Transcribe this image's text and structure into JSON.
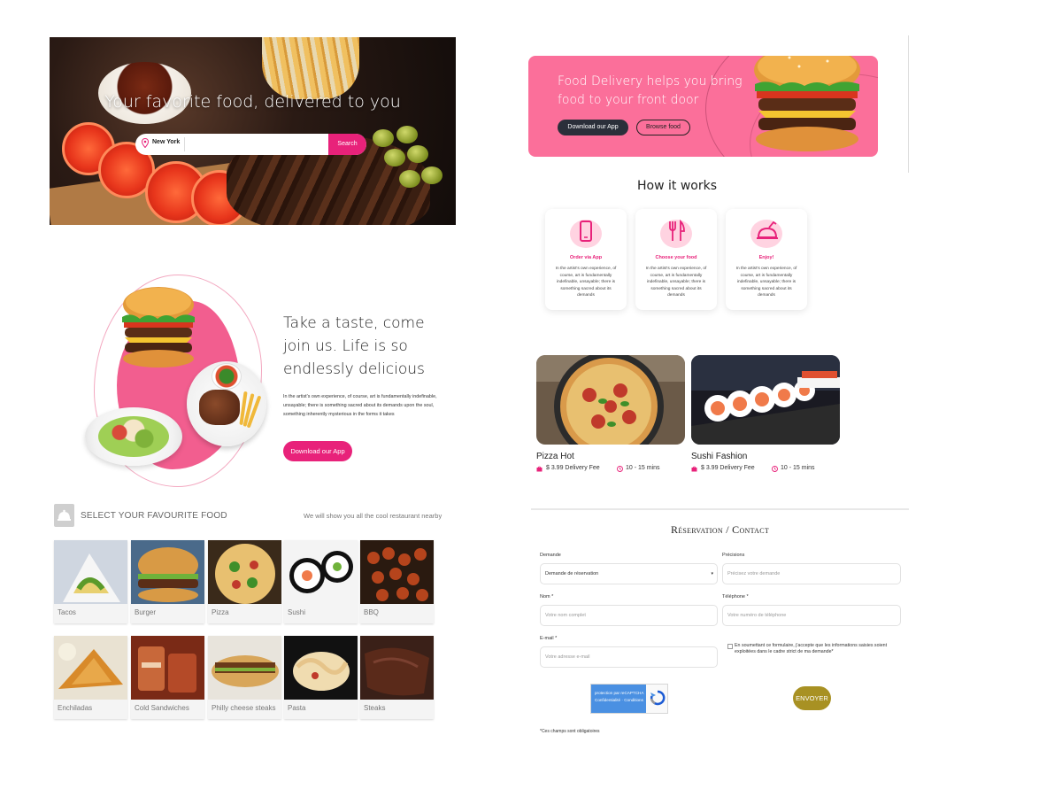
{
  "hero": {
    "title": "Your favorite food, delivered to you",
    "location_value": "New York",
    "search_button": "Search"
  },
  "banner": {
    "headline": "Food Delivery helps you bring food to your front door",
    "download_button": "Download our App",
    "browse_button": "Browse food",
    "color": "#fb6f9a"
  },
  "how": {
    "title": "How it works",
    "steps": [
      {
        "title": "Order via App",
        "desc": "In the artist's own experience, of course, art is fundamentally indefinable, unsayable; there is something sacred about its demands",
        "icon": "phone-icon"
      },
      {
        "title": "Choose your food",
        "desc": "In the artist's own experience, of course, art is fundamentally indefinable, unsayable; there is something sacred about its demands",
        "icon": "fork-knife-icon"
      },
      {
        "title": "Enjoy!",
        "desc": "In the artist's own experience, of course, art is fundamentally indefinable, unsayable; there is something sacred about its demands",
        "icon": "food-cover-icon"
      }
    ]
  },
  "restaurants": [
    {
      "name": "Pizza Hot",
      "fee": "$ 3.99 Delivery Fee",
      "time": "10 - 15 mins"
    },
    {
      "name": "Sushi Fashion",
      "fee": "$ 3.99 Delivery Fee",
      "time": "10 - 15 mins"
    }
  ],
  "taste": {
    "heading": "Take a taste, come join us. Life is so endlessly delicious",
    "paragraph": "In the artist's own experience, of course, art is fundamentally indefinable, unsayable; there is something sacred about its demands upon the soul, something inherently mysterious in the forms it takes",
    "button": "Download our App"
  },
  "select_food": {
    "title": "SELECT YOUR FAVOURITE FOOD",
    "subtitle": "We will show you all the cool restaurant nearby",
    "items": [
      "Tacos",
      "Burger",
      "Pizza",
      "Sushi",
      "BBQ",
      "Enchiladas",
      "Cold Sandwiches",
      "Philly cheese steaks",
      "Pasta",
      "Steaks"
    ]
  },
  "reservation": {
    "title": "Réservation / Contact",
    "demande_label": "Demande",
    "demande_value": "Demande de réservation",
    "precisions_label": "Précisions",
    "precisions_placeholder": "Précisez votre demande",
    "nom_label": "Nom *",
    "nom_placeholder": "Votre nom complet",
    "telephone_label": "Téléphone *",
    "telephone_placeholder": "Votre numéro de téléphone",
    "email_label": "E-mail *",
    "email_placeholder": "Votre adresse e-mail",
    "consent": "En soumettant ce formulaire, j'accepte que les informations saisies soient exploitées dans le cadre strict de ma demande*",
    "captcha_line1": "protection par reCAPTCHA",
    "captcha_line2": "Confidentialité · Conditions",
    "send_button": "ENVOYER",
    "required_note": "*Ces champs sont obligatoires"
  },
  "colors": {
    "accent": "#e8227a",
    "send": "#a89123"
  }
}
